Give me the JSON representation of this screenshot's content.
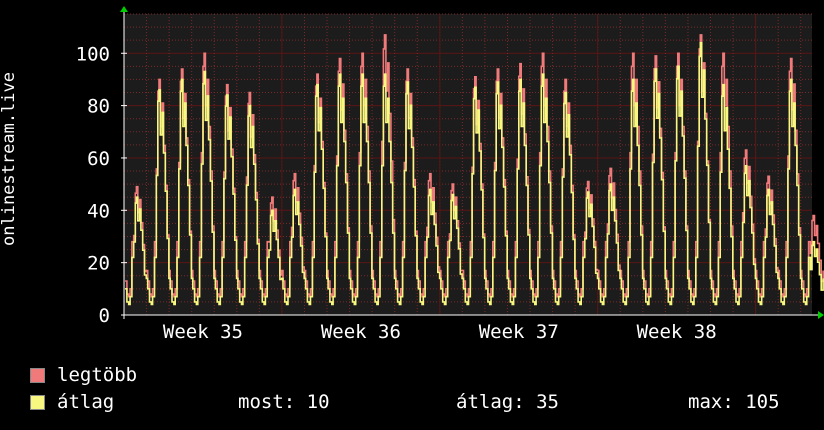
{
  "colors": {
    "background": "#000000",
    "plot_background": "#1c1c1c",
    "grid": "#5a1515",
    "grid_dotted": "#7a2a2a",
    "axis": "#ffffff",
    "text": "#ffffff",
    "arrow": "#00cc00",
    "max_series": "#f07a7a",
    "avg_series": "#f8f880"
  },
  "chart_data": {
    "type": "line",
    "ylabel": "onlinestream.live",
    "ylim": [
      0,
      115
    ],
    "yticks": [
      0,
      20,
      40,
      60,
      80,
      100
    ],
    "xlabels": [
      "Week 35",
      "Week 36",
      "Week 37",
      "Week 38"
    ],
    "xlabel_positions_days": [
      3.5,
      10.5,
      17.5,
      24.5
    ],
    "days": 30.5,
    "grid": true,
    "daily_peaks": [
      {
        "max": 49,
        "avg": 45
      },
      {
        "max": 90,
        "avg": 86
      },
      {
        "max": 94,
        "avg": 90
      },
      {
        "max": 100,
        "avg": 93
      },
      {
        "max": 88,
        "avg": 84
      },
      {
        "max": 85,
        "avg": 80
      },
      {
        "max": 45,
        "avg": 40
      },
      {
        "max": 54,
        "avg": 48
      },
      {
        "max": 92,
        "avg": 88
      },
      {
        "max": 98,
        "avg": 92
      },
      {
        "max": 100,
        "avg": 92
      },
      {
        "max": 107,
        "avg": 92
      },
      {
        "max": 94,
        "avg": 89
      },
      {
        "max": 54,
        "avg": 48
      },
      {
        "max": 50,
        "avg": 46
      },
      {
        "max": 91,
        "avg": 87
      },
      {
        "max": 94,
        "avg": 89
      },
      {
        "max": 96,
        "avg": 90
      },
      {
        "max": 100,
        "avg": 92
      },
      {
        "max": 90,
        "avg": 85
      },
      {
        "max": 51,
        "avg": 47
      },
      {
        "max": 56,
        "avg": 50
      },
      {
        "max": 100,
        "avg": 90
      },
      {
        "max": 99,
        "avg": 94
      },
      {
        "max": 100,
        "avg": 95
      },
      {
        "max": 107,
        "avg": 104
      },
      {
        "max": 100,
        "avg": 88
      },
      {
        "max": 63,
        "avg": 57
      },
      {
        "max": 53,
        "avg": 48
      },
      {
        "max": 98,
        "avg": 90
      },
      {
        "max": 38,
        "avg": 28
      }
    ],
    "series": [
      {
        "name": "legtöbb",
        "color": "#f07a7a"
      },
      {
        "name": "átlag",
        "color": "#f8f880"
      }
    ]
  },
  "legend": {
    "max_label": "legtöbb",
    "avg_label": "átlag"
  },
  "stats": {
    "now": "most: 10",
    "avg": "átlag: 35",
    "max": "max: 105"
  }
}
